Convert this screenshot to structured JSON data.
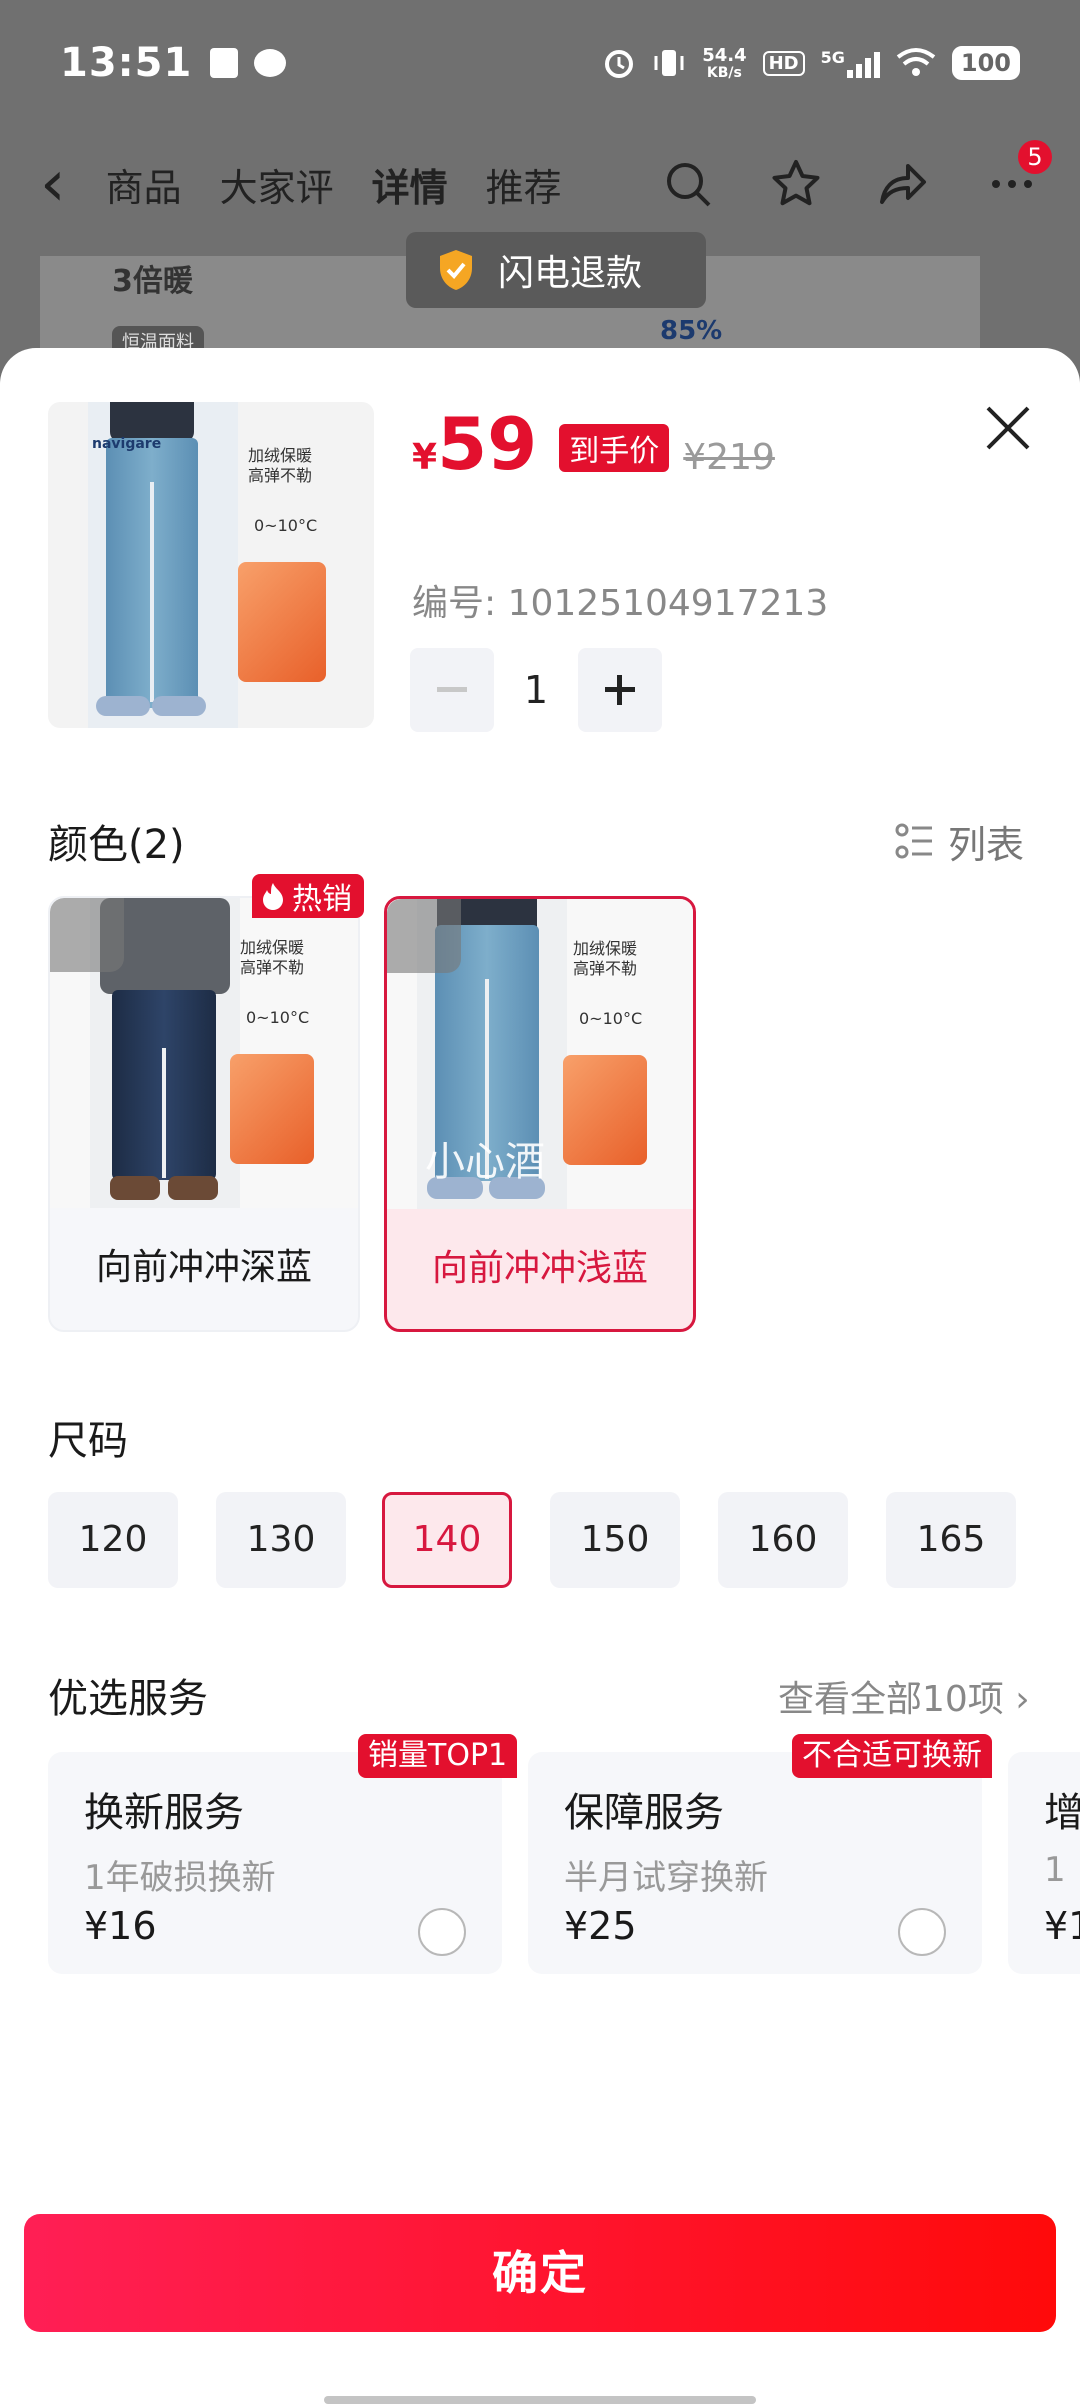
{
  "status_bar": {
    "time": "13:51",
    "speed_value": "54.4",
    "speed_unit": "KB/s",
    "hd": "HD",
    "network": "5G",
    "battery": "100"
  },
  "nav": {
    "tabs": [
      "商品",
      "大家评",
      "详情",
      "推荐"
    ],
    "active_tab": "详情",
    "badge_count": "5"
  },
  "background": {
    "banner_line1": "3倍暖",
    "banner_pill": "恒温面料",
    "banner_pct": "85%",
    "flash_refund": "闪电退款"
  },
  "product": {
    "price_symbol": "¥",
    "price": "59",
    "price_tag": "到手价",
    "old_price": "¥219",
    "code_label": "编号: 10125104917213",
    "quantity": "1",
    "img_text_1": "加绒保暖",
    "img_text_2": "高弹不勒",
    "img_temp": "0~10°C",
    "brand": "navigare"
  },
  "colors": {
    "title": "颜色(2)",
    "list_toggle": "列表",
    "hot_badge": "热销",
    "options": [
      {
        "label": "向前冲冲深蓝",
        "selected": false
      },
      {
        "label": "向前冲冲浅蓝",
        "selected": true
      }
    ],
    "watermark": "小心酒"
  },
  "sizes": {
    "title": "尺码",
    "options": [
      "120",
      "130",
      "140",
      "150",
      "160",
      "165"
    ],
    "selected": "140"
  },
  "services": {
    "title": "优选服务",
    "view_all": "查看全部10项 ›",
    "cards": [
      {
        "name": "换新服务",
        "desc": "1年破损换新",
        "price": "¥16",
        "tag": "销量TOP1"
      },
      {
        "name": "保障服务",
        "desc": "半月试穿换新",
        "price": "¥25",
        "tag": "不合适可换新"
      },
      {
        "name": "增",
        "desc": "1",
        "price": "¥1"
      }
    ]
  },
  "confirm": "确定",
  "colors_theme": {
    "accent": "#e3102e",
    "selected_bg": "#fde8ec"
  }
}
